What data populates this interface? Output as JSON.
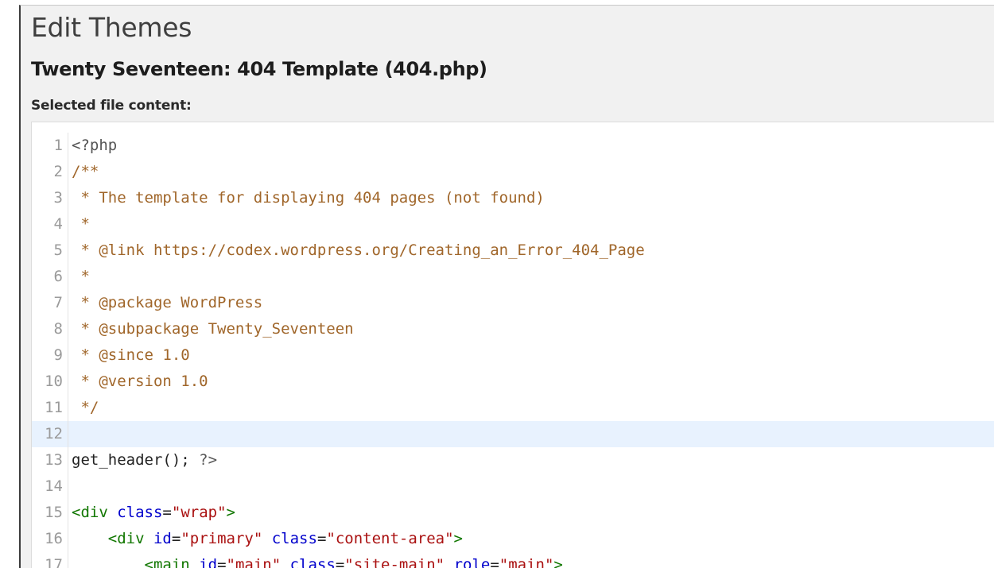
{
  "page": {
    "title": "Edit Themes",
    "file_title": "Twenty Seventeen: 404 Template (404.php)",
    "content_label": "Selected file content:"
  },
  "editor": {
    "active_line": 12,
    "lines": [
      {
        "n": "1",
        "tokens": [
          {
            "t": "<?php",
            "k": "meta"
          }
        ]
      },
      {
        "n": "2",
        "tokens": [
          {
            "t": "/**",
            "k": "comment"
          }
        ]
      },
      {
        "n": "3",
        "tokens": [
          {
            "t": " * The template for displaying 404 pages (not found)",
            "k": "comment"
          }
        ]
      },
      {
        "n": "4",
        "tokens": [
          {
            "t": " *",
            "k": "comment"
          }
        ]
      },
      {
        "n": "5",
        "tokens": [
          {
            "t": " * @link https://codex.wordpress.org/Creating_an_Error_404_Page",
            "k": "comment"
          }
        ]
      },
      {
        "n": "6",
        "tokens": [
          {
            "t": " *",
            "k": "comment"
          }
        ]
      },
      {
        "n": "7",
        "tokens": [
          {
            "t": " * @package WordPress",
            "k": "comment"
          }
        ]
      },
      {
        "n": "8",
        "tokens": [
          {
            "t": " * @subpackage Twenty_Seventeen",
            "k": "comment"
          }
        ]
      },
      {
        "n": "9",
        "tokens": [
          {
            "t": " * @since 1.0",
            "k": "comment"
          }
        ]
      },
      {
        "n": "10",
        "tokens": [
          {
            "t": " * @version 1.0",
            "k": "comment"
          }
        ]
      },
      {
        "n": "11",
        "tokens": [
          {
            "t": " */",
            "k": "comment"
          }
        ]
      },
      {
        "n": "12",
        "tokens": []
      },
      {
        "n": "13",
        "tokens": [
          {
            "t": "get_header(); ",
            "k": "plain"
          },
          {
            "t": "?>",
            "k": "meta"
          }
        ]
      },
      {
        "n": "14",
        "tokens": []
      },
      {
        "n": "15",
        "tokens": [
          {
            "t": "<div",
            "k": "tag"
          },
          {
            "t": " ",
            "k": "plain"
          },
          {
            "t": "class",
            "k": "attr"
          },
          {
            "t": "=",
            "k": "plain"
          },
          {
            "t": "\"wrap\"",
            "k": "str"
          },
          {
            "t": ">",
            "k": "tag"
          }
        ]
      },
      {
        "n": "16",
        "tokens": [
          {
            "t": "    ",
            "k": "plain"
          },
          {
            "t": "<div",
            "k": "tag"
          },
          {
            "t": " ",
            "k": "plain"
          },
          {
            "t": "id",
            "k": "attr"
          },
          {
            "t": "=",
            "k": "plain"
          },
          {
            "t": "\"primary\"",
            "k": "str"
          },
          {
            "t": " ",
            "k": "plain"
          },
          {
            "t": "class",
            "k": "attr"
          },
          {
            "t": "=",
            "k": "plain"
          },
          {
            "t": "\"content-area\"",
            "k": "str"
          },
          {
            "t": ">",
            "k": "tag"
          }
        ]
      },
      {
        "n": "17",
        "tokens": [
          {
            "t": "        ",
            "k": "plain"
          },
          {
            "t": "<main",
            "k": "tag"
          },
          {
            "t": " ",
            "k": "plain"
          },
          {
            "t": "id",
            "k": "attr"
          },
          {
            "t": "=",
            "k": "plain"
          },
          {
            "t": "\"main\"",
            "k": "str"
          },
          {
            "t": " ",
            "k": "plain"
          },
          {
            "t": "class",
            "k": "attr"
          },
          {
            "t": "=",
            "k": "plain"
          },
          {
            "t": "\"site-main\"",
            "k": "str"
          },
          {
            "t": " ",
            "k": "plain"
          },
          {
            "t": "role",
            "k": "attr"
          },
          {
            "t": "=",
            "k": "plain"
          },
          {
            "t": "\"main\"",
            "k": "str"
          },
          {
            "t": ">",
            "k": "tag"
          }
        ]
      }
    ]
  }
}
